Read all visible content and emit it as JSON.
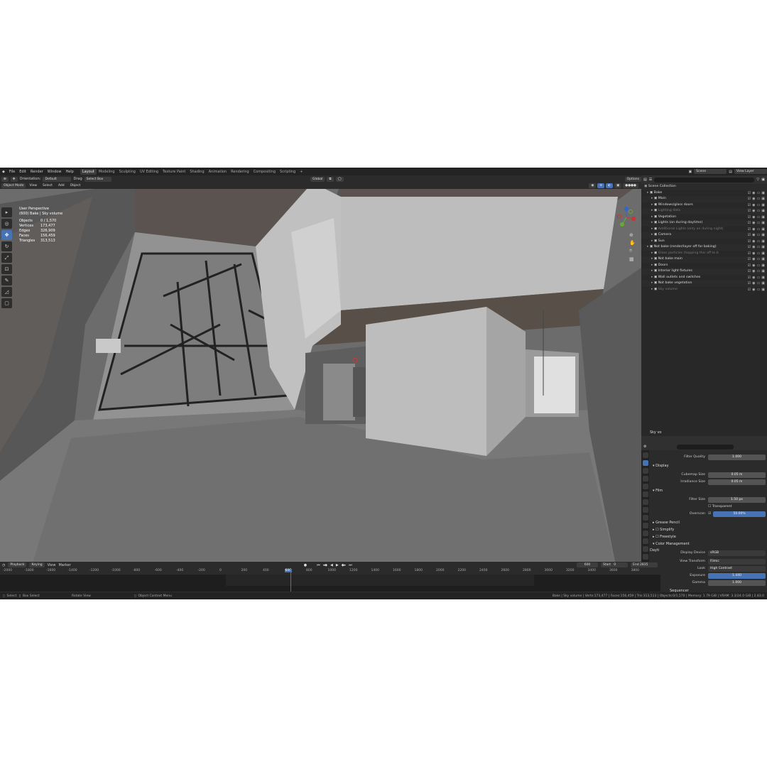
{
  "menu": [
    "File",
    "Edit",
    "Render",
    "Window",
    "Help"
  ],
  "workspaces": [
    "Layout",
    "Modeling",
    "Sculpting",
    "UV Editing",
    "Texture Paint",
    "Shading",
    "Animation",
    "Rendering",
    "Compositing",
    "Scripting"
  ],
  "active_workspace": "Layout",
  "scene": "Scene",
  "view_layer": "View Layer",
  "header": {
    "orientation_label": "Orientation:",
    "orientation_value": "Default",
    "drag_label": "Drag",
    "drag_value": "Select Box",
    "transform": "Global",
    "options": "Options"
  },
  "header2": {
    "mode": "Object Mode",
    "view": "View",
    "select": "Select",
    "add": "Add",
    "object": "Object"
  },
  "overlay": {
    "perspective": "User Perspective",
    "context": "(600) Bake | Sky volume",
    "stats": [
      {
        "label": "Objects",
        "value": "0 / 1,570"
      },
      {
        "label": "Vertices",
        "value": "173,477"
      },
      {
        "label": "Edges",
        "value": "326,909"
      },
      {
        "label": "Faces",
        "value": "156,459"
      },
      {
        "label": "Triangles",
        "value": "313,513"
      }
    ]
  },
  "outliner": {
    "root": "Scene Collection",
    "items": [
      {
        "label": "Bake",
        "dim": false
      },
      {
        "label": "Main",
        "dim": false
      },
      {
        "label": "Windows/glass doors",
        "dim": false
      },
      {
        "label": "Lighting data",
        "dim": true
      },
      {
        "label": "Vegetation",
        "dim": false
      },
      {
        "label": "Lights (on during daytime)",
        "dim": false
      },
      {
        "label": "Additional Lights (only on during night)",
        "dim": true
      },
      {
        "label": "Camera",
        "dim": false
      },
      {
        "label": "Sun",
        "dim": false
      },
      {
        "label": "Not bake (render/layer off for baking)",
        "dim": false
      },
      {
        "label": "Glass particles (hopping this off to b",
        "dim": true
      },
      {
        "label": "Not bake main",
        "dim": false
      },
      {
        "label": "Doors",
        "dim": false
      },
      {
        "label": "Interior light fixtures",
        "dim": false
      },
      {
        "label": "Wall outlets and switches",
        "dim": false
      },
      {
        "label": "Not bake vegetation",
        "dim": false
      },
      {
        "label": "Sky volume",
        "dim": true
      }
    ]
  },
  "side_label": "Sky vo",
  "side_label2": "Dayti",
  "props": {
    "filter_quality_label": "Filter Quality",
    "filter_quality": "1.000",
    "display_head": "Display",
    "cubemap_label": "Cubemap Size",
    "cubemap": "0.05 m",
    "irradiance_label": "Irradiance Size",
    "irradiance": "0.05 m",
    "film_head": "Film",
    "filter_size_label": "Filter Size",
    "filter_size": "1.50 px",
    "transparent": "Transparent",
    "overscan_label": "Overscan",
    "overscan": "50.00%",
    "grease_head": "Grease Pencil",
    "simplify_head": "Simplify",
    "freestyle_head": "Freestyle",
    "color_head": "Color Management",
    "display_device_label": "Display Device",
    "display_device": "sRGB",
    "view_transform_label": "View Transform",
    "view_transform": "Filmic",
    "look_label": "Look",
    "look": "High Contrast",
    "exposure_label": "Exposure",
    "exposure": "1.440",
    "gamma_label": "Gamma",
    "gamma": "1.000",
    "sequencer": "Sequencer"
  },
  "timeline": {
    "playback": "Playback",
    "keying": "Keying",
    "view": "View",
    "marker": "Marker",
    "current": "600",
    "start_label": "Start",
    "start": "0",
    "end_label": "End",
    "end": "2835",
    "ticks": [
      "-2000",
      "-1800",
      "-1600",
      "-1400",
      "-1200",
      "-1000",
      "-800",
      "-600",
      "-400",
      "-200",
      "0",
      "200",
      "400",
      "600",
      "800",
      "1000",
      "1200",
      "1400",
      "1600",
      "1800",
      "2000",
      "2200",
      "2400",
      "2600",
      "2800",
      "3000",
      "3200",
      "3400",
      "3600",
      "3800"
    ]
  },
  "status": {
    "select": "Select",
    "box_select": "Box Select",
    "rotate": "Rotate View",
    "context_menu": "Object Context Menu",
    "info": "Bake | Sky volume | Verts:173,477 | Faces:156,459 | Tris:313,513 | Objects:0/1,570 | Memory: 1.79 GiB | VRAM: 3.3/24.0 GiB | 2.83.0"
  }
}
